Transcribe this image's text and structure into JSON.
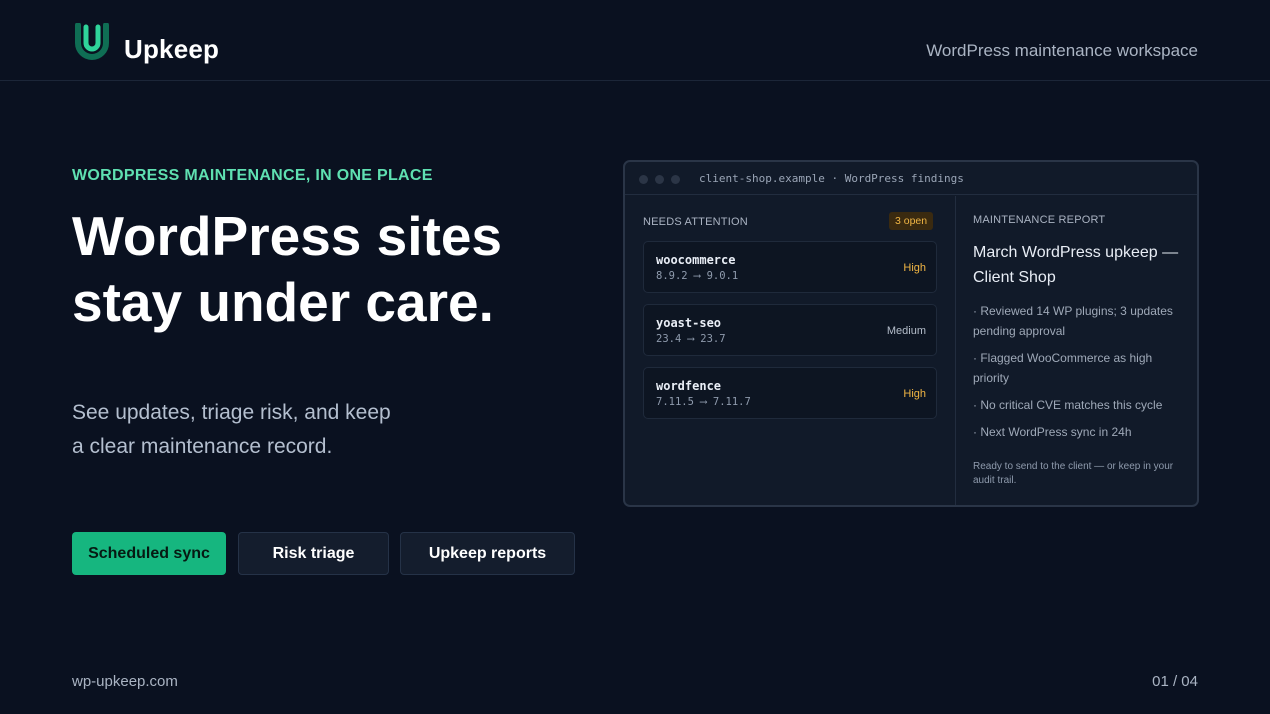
{
  "header": {
    "brand": "Upkeep",
    "subtitle": "WordPress maintenance workspace"
  },
  "hero": {
    "eyebrow": "WORDPRESS MAINTENANCE, IN ONE PLACE",
    "headline_line1": "WordPress sites",
    "headline_line2": "stay under care.",
    "subcopy_line1": "See updates, triage risk, and keep",
    "subcopy_line2": "a clear maintenance record."
  },
  "buttons": {
    "scheduled_sync": "Scheduled sync",
    "risk_triage": "Risk triage",
    "upkeep_reports": "Upkeep reports"
  },
  "window": {
    "title": "client-shop.example · WordPress findings",
    "needs_attention_label": "NEEDS ATTENTION",
    "open_count": "3 open",
    "findings": [
      {
        "name": "woocommerce",
        "version": "8.9.2 ⟶ 9.0.1",
        "severity": "High"
      },
      {
        "name": "yoast-seo",
        "version": "23.4 ⟶ 23.7",
        "severity": "Medium"
      },
      {
        "name": "wordfence",
        "version": "7.11.5 ⟶ 7.11.7",
        "severity": "High"
      }
    ],
    "report": {
      "label": "MAINTENANCE REPORT",
      "title": "March WordPress upkeep — Client Shop",
      "items": [
        "· Reviewed 14 WP plugins; 3 updates pending approval",
        "· Flagged WooCommerce as high priority",
        "· No critical CVE matches this cycle",
        "· Next WordPress sync in 24h"
      ],
      "footer": "Ready to send to the client — or keep in your audit trail."
    }
  },
  "footer": {
    "url": "wp-upkeep.com",
    "page": "01 / 04"
  },
  "colors": {
    "background": "#0a1120",
    "accent": "#16b67f",
    "eyebrow": "#5fe0b1",
    "severity_high": "#f0b544"
  }
}
